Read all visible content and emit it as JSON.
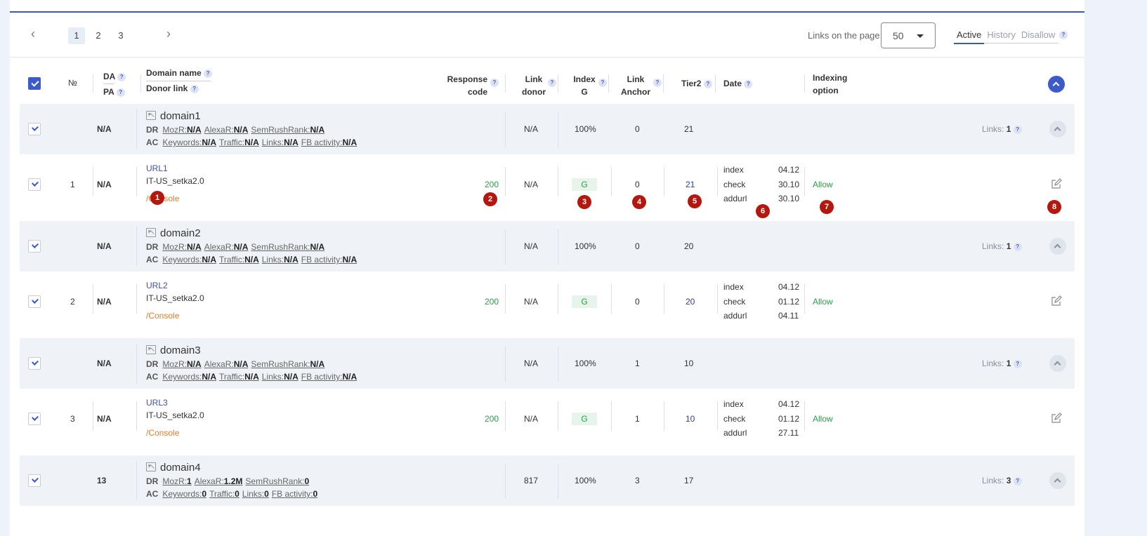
{
  "toolbar": {
    "prev_icon": "‹",
    "next_icon": "›",
    "pages": [
      "1",
      "2",
      "3"
    ],
    "active_page": "1",
    "links_on_page_label": "Links on the page",
    "links_on_page_value": "50",
    "tabs": [
      "Active",
      "History",
      "Disallow"
    ],
    "active_tab": "Active"
  },
  "header": {
    "number": "№",
    "da": "DA",
    "pa": "PA",
    "domain_name": "Domain name",
    "donor_link": "Donor link",
    "response_code_1": "Response",
    "response_code_2": "code",
    "link_donor_1": "Link",
    "link_donor_2": "donor",
    "index_g_1": "Index",
    "index_g_2": "G",
    "link_anchor_1": "Link",
    "link_anchor_2": "Anchor",
    "tier2": "Tier2",
    "date": "Date",
    "indexing_option_1": "Indexing",
    "indexing_option_2": "option",
    "help": "?"
  },
  "labels": {
    "dr": "DR",
    "ac": "AC",
    "mozr": "MozR:",
    "alexar": "AlexaR:",
    "semrush": "SemRushRank:",
    "keywords": "Keywords:",
    "traffic": "Traffic:",
    "links": "Links:",
    "fb": "FB activity:",
    "links_count": "Links:",
    "date_index": "index",
    "date_check": "check",
    "date_addurl": "addurl"
  },
  "groups": [
    {
      "da": "N/A",
      "domain": "domain1",
      "mozr": "N/A",
      "alexar": "N/A",
      "semrush": "N/A",
      "keywords": "N/A",
      "traffic": "N/A",
      "links": "N/A",
      "fb": "N/A",
      "link_donor": "N/A",
      "index_g": "100%",
      "link_anchor": "0",
      "tier2": "21",
      "links_count": "1"
    },
    {
      "da": "N/A",
      "domain": "domain2",
      "mozr": "N/A",
      "alexar": "N/A",
      "semrush": "N/A",
      "keywords": "N/A",
      "traffic": "N/A",
      "links": "N/A",
      "fb": "N/A",
      "link_donor": "N/A",
      "index_g": "100%",
      "link_anchor": "0",
      "tier2": "20",
      "links_count": "1"
    },
    {
      "da": "N/A",
      "domain": "domain3",
      "mozr": "N/A",
      "alexar": "N/A",
      "semrush": "N/A",
      "keywords": "N/A",
      "traffic": "N/A",
      "links": "N/A",
      "fb": "N/A",
      "link_donor": "N/A",
      "index_g": "100%",
      "link_anchor": "1",
      "tier2": "10",
      "links_count": "1"
    },
    {
      "da": "13",
      "domain": "domain4",
      "mozr": "1",
      "alexar": "1.2M",
      "semrush": "0",
      "keywords": "0",
      "traffic": "0",
      "links": "0",
      "fb": "0",
      "link_donor": "817",
      "index_g": "100%",
      "link_anchor": "3",
      "tier2": "17",
      "links_count": "3"
    }
  ],
  "rows": [
    {
      "num": "1",
      "pa": "N/A",
      "url": "URL1",
      "project": "IT-US_setka2.0",
      "console": "/Console",
      "response": "200",
      "link_donor": "N/A",
      "index_g": "G",
      "link_anchor": "0",
      "tier2": "21",
      "date_index": "04.12",
      "date_check": "30.10",
      "date_addurl": "30.10",
      "indexing": "Allow"
    },
    {
      "num": "2",
      "pa": "N/A",
      "url": "URL2",
      "project": "IT-US_setka2.0",
      "console": "/Console",
      "response": "200",
      "link_donor": "N/A",
      "index_g": "G",
      "link_anchor": "0",
      "tier2": "20",
      "date_index": "04.12",
      "date_check": "01.12",
      "date_addurl": "04.11",
      "indexing": "Allow"
    },
    {
      "num": "3",
      "pa": "N/A",
      "url": "URL3",
      "project": "IT-US_setka2.0",
      "console": "/Console",
      "response": "200",
      "link_donor": "N/A",
      "index_g": "G",
      "link_anchor": "1",
      "tier2": "10",
      "date_index": "04.12",
      "date_check": "01.12",
      "date_addurl": "27.11",
      "indexing": "Allow"
    }
  ],
  "markers": [
    "1",
    "2",
    "3",
    "4",
    "5",
    "6",
    "7",
    "8"
  ]
}
